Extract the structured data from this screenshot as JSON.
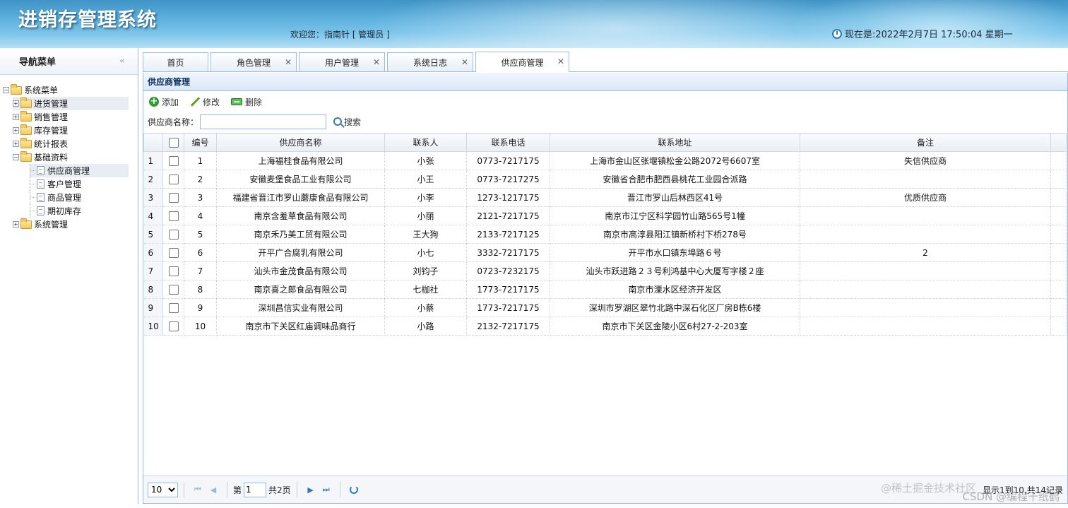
{
  "header": {
    "app_title": "进销存管理系统",
    "welcome": "欢迎您：指南针 [ 管理员 ]",
    "datetime": "现在是:2022年2月7日 17:50:04 星期一"
  },
  "nav": {
    "title": "导航菜单",
    "collapse": "«",
    "root": "系统菜单",
    "groups": [
      "进货管理",
      "销售管理",
      "库存管理",
      "统计报表"
    ],
    "basic_group": "基础资料",
    "basic_items": [
      "供应商管理",
      "客户管理",
      "商品管理",
      "期初库存"
    ],
    "system_group": "系统管理"
  },
  "tabs": [
    {
      "label": "首页"
    },
    {
      "label": "角色管理"
    },
    {
      "label": "用户管理"
    },
    {
      "label": "系统日志"
    },
    {
      "label": "供应商管理"
    }
  ],
  "panel": {
    "title": "供应商管理",
    "toolbar": {
      "add": "添加",
      "edit": "修改",
      "delete": "删除"
    },
    "search": {
      "label": "供应商名称：",
      "value": "",
      "button": "搜索"
    }
  },
  "grid": {
    "columns": [
      "编号",
      "供应商名称",
      "联系人",
      "联系电话",
      "联系地址",
      "备注"
    ],
    "rows": [
      [
        "1",
        "1",
        "上海福桂食品有限公司",
        "小张",
        "0773-7217175",
        "上海市金山区张堰镇松金公路2072号6607室",
        "失信供应商"
      ],
      [
        "2",
        "2",
        "安徽麦堡食品工业有限公司",
        "小王",
        "0773-7217275",
        "安徽省合肥市肥西县桃花工业园合派路",
        ""
      ],
      [
        "3",
        "3",
        "福建省晋江市罗山蘑康食品有限公司",
        "小李",
        "1273-1217175",
        "晋江市罗山后林西区41号",
        "优质供应商"
      ],
      [
        "4",
        "4",
        "南京含羞草食品有限公司",
        "小丽",
        "2121-7217175",
        "南京市江宁区科学园竹山路565号1幢",
        ""
      ],
      [
        "5",
        "5",
        "南京禾乃美工贸有限公司",
        "王大狗",
        "2133-7217125",
        "南京市高淳县阳江镇新桥村下桥278号",
        ""
      ],
      [
        "6",
        "6",
        "开平广合腐乳有限公司",
        "小七",
        "3332-7217175",
        "开平市水口镇东埠路６号",
        "2"
      ],
      [
        "7",
        "7",
        "汕头市金茂食品有限公司",
        "刘钧子",
        "0723-7232175",
        "汕头市跃进路２３号利鸿基中心大厦写字楼２座",
        ""
      ],
      [
        "8",
        "8",
        "南京喜之郎食品有限公司",
        "七枷社",
        "1773-7217175",
        "南京市溧水区经济开发区",
        ""
      ],
      [
        "9",
        "9",
        "深圳昌信实业有限公司",
        "小蔡",
        "1773-7217175",
        "深圳市罗湖区翠竹北路中深石化区厂房B栋6楼",
        ""
      ],
      [
        "10",
        "10",
        "南京市下关区红庙调味品商行",
        "小路",
        "2132-7217175",
        "南京市下关区金陵小区6村27-2-203室",
        ""
      ]
    ]
  },
  "pager": {
    "page_size": "10",
    "page_prefix": "第",
    "page_value": "1",
    "page_suffix": "共2页",
    "info": "显示1到10,共14记录"
  },
  "watermark": {
    "line1": "@稀土掘金技术社区",
    "line2": "CSDN @编程千纸鹤"
  }
}
